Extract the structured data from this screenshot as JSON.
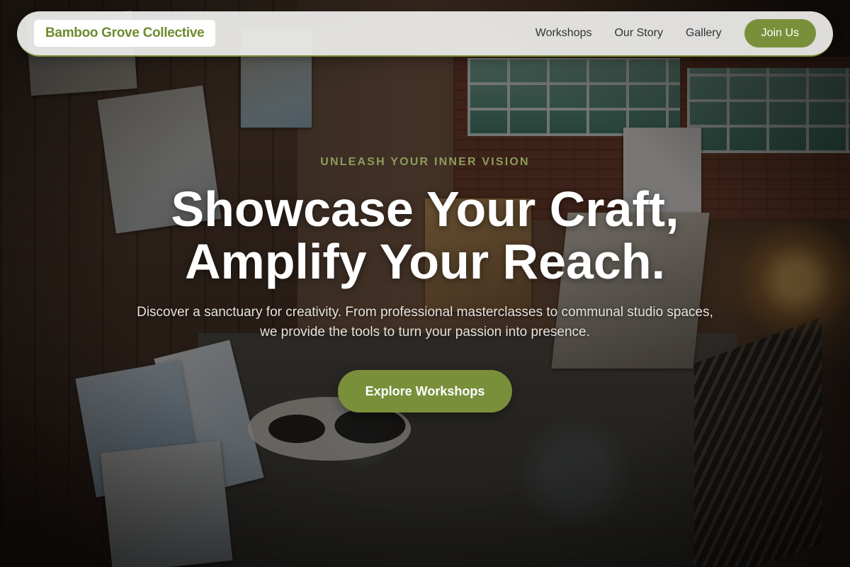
{
  "nav": {
    "brand": "Bamboo Grove Collective",
    "links": [
      {
        "label": "Workshops"
      },
      {
        "label": "Our Story"
      },
      {
        "label": "Gallery"
      }
    ],
    "cta_label": "Join Us"
  },
  "hero": {
    "eyebrow": "UNLEASH YOUR INNER VISION",
    "headline_line1": "Showcase Your Craft,",
    "headline_line2": "Amplify Your Reach.",
    "subtext_line1": "Discover a sanctuary for creativity. From professional masterclasses to communal studio spaces,",
    "subtext_line2": "we provide the tools to turn your passion into presence.",
    "cta_label": "Explore Workshops"
  },
  "colors": {
    "accent": "#7a8f3a",
    "brand_text": "#6f8a2f",
    "eyebrow": "#8d9c5e",
    "nav_background": "#f0f0ee",
    "overlay": "#0f0c0a"
  }
}
